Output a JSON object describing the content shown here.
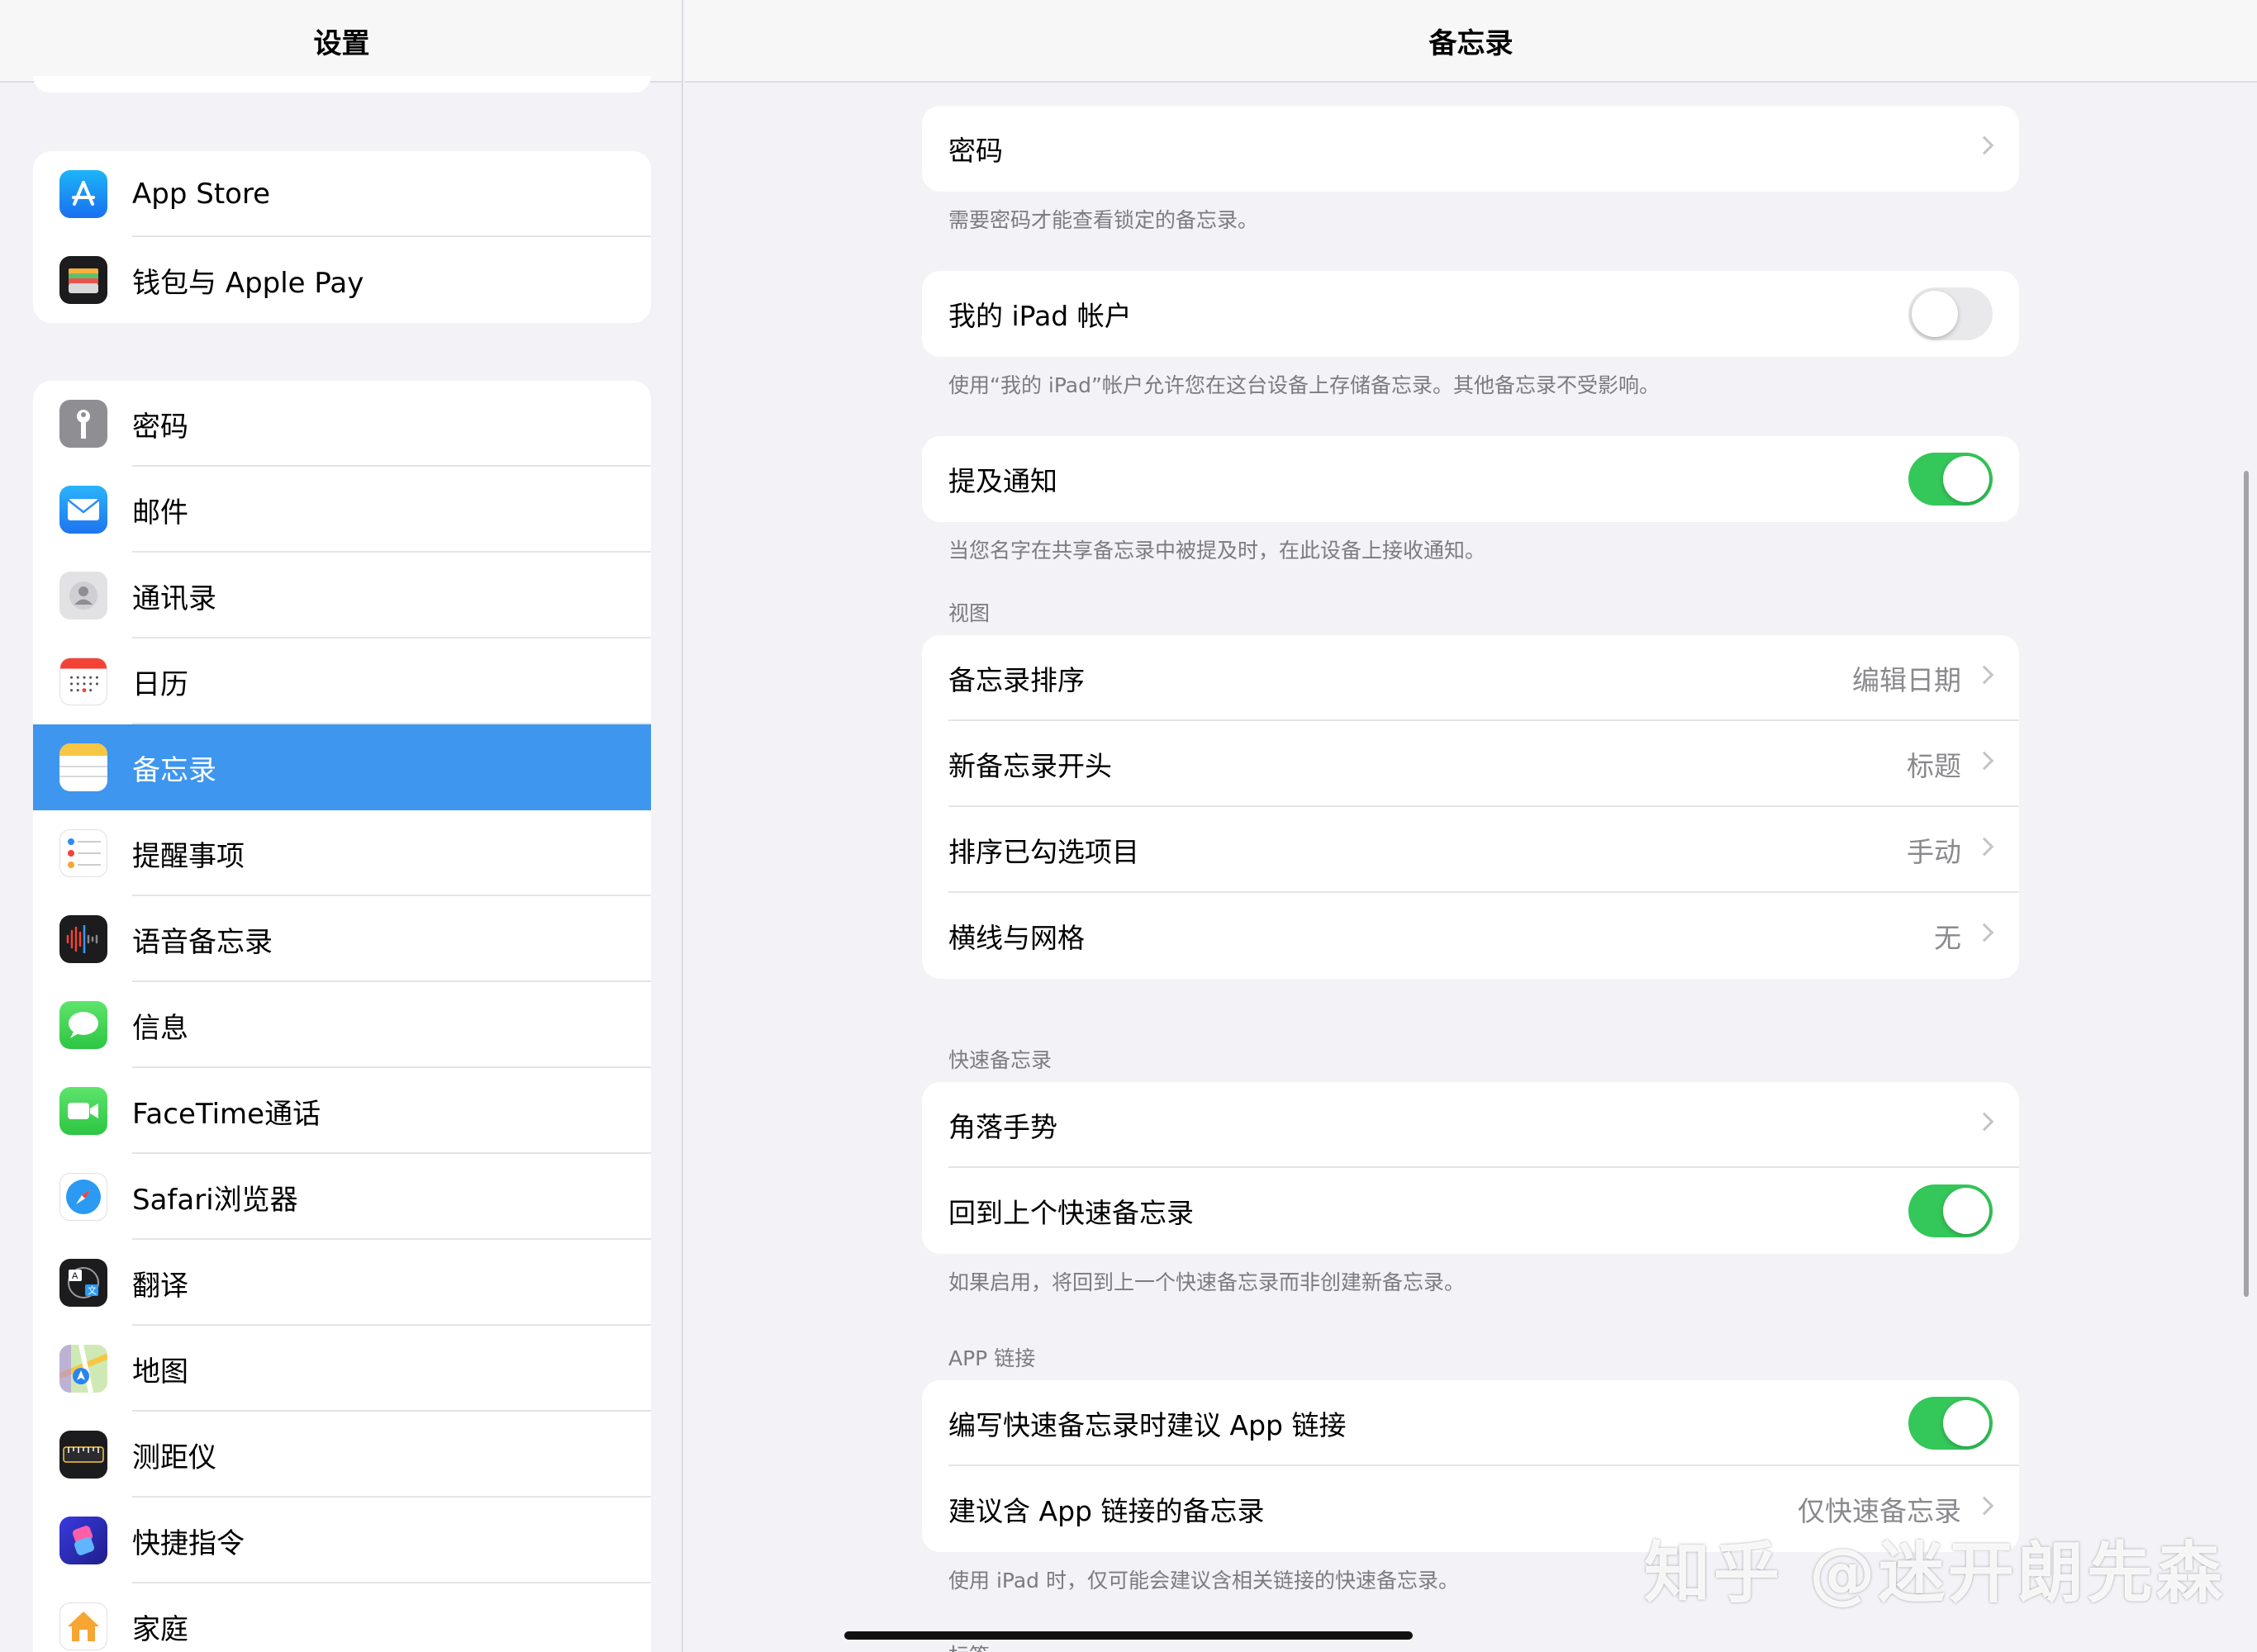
{
  "sidebar": {
    "title": "设置",
    "group1": [
      {
        "label": "App Store",
        "icon": "app-store-icon"
      },
      {
        "label": "钱包与 Apple Pay",
        "icon": "wallet-icon"
      }
    ],
    "group2": [
      {
        "label": "密码",
        "icon": "key-icon"
      },
      {
        "label": "邮件",
        "icon": "mail-icon"
      },
      {
        "label": "通讯录",
        "icon": "contacts-icon"
      },
      {
        "label": "日历",
        "icon": "calendar-icon"
      },
      {
        "label": "备忘录",
        "icon": "notes-icon",
        "selected": true
      },
      {
        "label": "提醒事项",
        "icon": "reminders-icon"
      },
      {
        "label": "语音备忘录",
        "icon": "voice-memos-icon"
      },
      {
        "label": "信息",
        "icon": "messages-icon"
      },
      {
        "label": "FaceTime通话",
        "icon": "facetime-icon"
      },
      {
        "label": "Safari浏览器",
        "icon": "safari-icon"
      },
      {
        "label": "翻译",
        "icon": "translate-icon"
      },
      {
        "label": "地图",
        "icon": "maps-icon"
      },
      {
        "label": "测距仪",
        "icon": "measure-icon"
      },
      {
        "label": "快捷指令",
        "icon": "shortcuts-icon"
      },
      {
        "label": "家庭",
        "icon": "home-icon"
      }
    ]
  },
  "main": {
    "title": "备忘录",
    "password": {
      "label": "密码",
      "note": "需要密码才能查看锁定的备忘录。"
    },
    "ipad_account": {
      "label": "我的 iPad 帐户",
      "toggle": false,
      "note": "使用“我的 iPad”帐户允许您在这台设备上存储备忘录。其他备忘录不受影响。"
    },
    "mentions": {
      "label": "提及通知",
      "toggle": true,
      "note": "当您名字在共享备忘录中被提及时，在此设备上接收通知。"
    },
    "view": {
      "header": "视图",
      "rows": [
        {
          "label": "备忘录排序",
          "value": "编辑日期"
        },
        {
          "label": "新备忘录开头",
          "value": "标题"
        },
        {
          "label": "排序已勾选项目",
          "value": "手动"
        },
        {
          "label": "横线与网格",
          "value": "无"
        }
      ]
    },
    "quick_notes": {
      "header": "快速备忘录",
      "corner_gestures": "角落手势",
      "resume_label": "回到上个快速备忘录",
      "resume_toggle": true,
      "note": "如果启用，将回到上一个快速备忘录而非创建新备忘录。"
    },
    "app_links": {
      "header": "APP 链接",
      "suggest_label": "编写快速备忘录时建议 App 链接",
      "suggest_toggle": true,
      "notes_label": "建议含 App 链接的备忘录",
      "notes_value": "仅快速备忘录",
      "note": "使用 iPad 时，仅可能会建议含相关链接的快速备忘录。"
    },
    "next_header": "标签"
  },
  "watermark": "知乎 @迷开朗先森",
  "colors": {
    "accent": "#3e96ee",
    "toggle_on": "#34c759"
  }
}
